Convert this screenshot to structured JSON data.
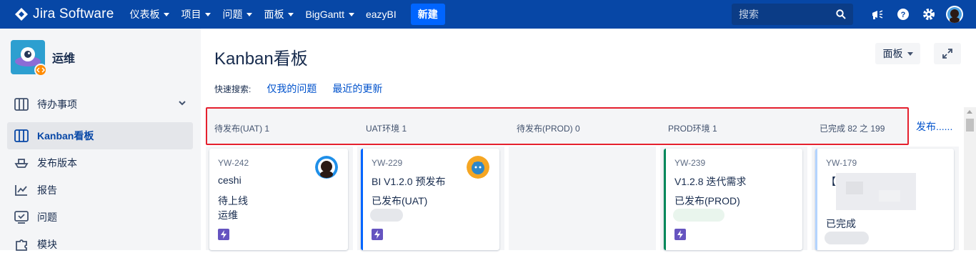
{
  "topnav": {
    "logo_text": "Jira Software",
    "items": [
      {
        "label": "仪表板",
        "dropdown": true
      },
      {
        "label": "项目",
        "dropdown": true
      },
      {
        "label": "问题",
        "dropdown": true
      },
      {
        "label": "面板",
        "dropdown": true
      },
      {
        "label": "BigGantt",
        "dropdown": true
      },
      {
        "label": "eazyBI",
        "dropdown": false
      }
    ],
    "create_label": "新建",
    "search_placeholder": "搜索",
    "icons": [
      "megaphone-icon",
      "help-icon",
      "settings-icon",
      "user-avatar"
    ],
    "colors": {
      "nav_bg": "#0747a6",
      "create_bg": "#0065ff"
    }
  },
  "sidebar": {
    "project_name": "运维",
    "items": [
      {
        "label": "待办事项",
        "icon": "backlog-icon",
        "active": false,
        "expandable": true
      },
      {
        "label": "Kanban看板",
        "icon": "board-icon",
        "active": true,
        "expandable": false
      },
      {
        "label": "发布版本",
        "icon": "ship-icon",
        "active": false,
        "expandable": false
      },
      {
        "label": "报告",
        "icon": "chart-icon",
        "active": false,
        "expandable": false
      },
      {
        "label": "问题",
        "icon": "issues-icon",
        "active": false,
        "expandable": false
      },
      {
        "label": "模块",
        "icon": "puzzle-icon",
        "active": false,
        "expandable": false
      }
    ]
  },
  "main": {
    "title": "Kanban看板",
    "board_button": "面板",
    "quick_filters_label": "快速搜索:",
    "quick_filters": [
      "仅我的问题",
      "最近的更新"
    ],
    "release_link": "发布......",
    "columns": [
      {
        "title": "待发布(UAT)  1"
      },
      {
        "title": "UAT环境  1"
      },
      {
        "title": "待发布(PROD)  0"
      },
      {
        "title": "PROD环境  1"
      },
      {
        "title": "已完成  82 之 199"
      }
    ],
    "cards": [
      {
        "key": "YW-242",
        "summary": "ceshi",
        "status": "待上线",
        "component": "运维"
      },
      {
        "key": "YW-229",
        "summary": "BI V1.2.0 预发布",
        "status": "已发布(UAT)"
      },
      {
        "key": "YW-239",
        "summary": "V1.2.8 迭代需求",
        "status": "已发布(PROD)"
      },
      {
        "key": "YW-179",
        "summary": "【",
        "status": "已完成"
      }
    ]
  }
}
